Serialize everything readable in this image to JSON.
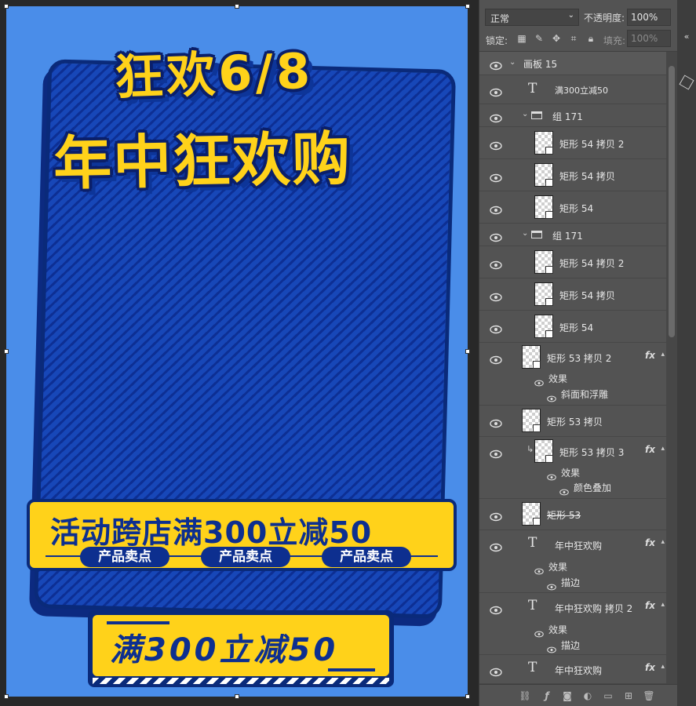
{
  "canvas": {
    "headline_top": "狂欢6/8",
    "headline_main": "年中狂欢购",
    "promo_text": "活动跨店满300立减50",
    "pills": [
      "产品卖点",
      "产品卖点",
      "产品卖点"
    ],
    "bottom_button_text": "满300立减50"
  },
  "layers_panel": {
    "blend_mode": "正常",
    "opacity_label": "不透明度:",
    "opacity_value": "100%",
    "lock_label": "锁定:",
    "fill_label": "填充:",
    "fill_value": "100%",
    "rows": [
      {
        "name": "画板 15"
      },
      {
        "name": "满300立减50"
      },
      {
        "name": "组 171"
      },
      {
        "name": "矩形 54 拷贝 2"
      },
      {
        "name": "矩形 54 拷贝"
      },
      {
        "name": "矩形 54"
      },
      {
        "name": "组 171"
      },
      {
        "name": "矩形 54 拷贝 2"
      },
      {
        "name": "矩形 54 拷贝"
      },
      {
        "name": "矩形 54"
      },
      {
        "name": "矩形 53 拷贝 2"
      },
      {
        "name": "矩形 53 拷贝"
      },
      {
        "name": "矩形 53 拷贝 3"
      },
      {
        "name": "矩形 53"
      },
      {
        "name": "年中狂欢购"
      },
      {
        "name": "年中狂欢购 拷贝 2"
      },
      {
        "name": "年中狂欢购"
      }
    ],
    "effects_label": "效果",
    "effect_bevel": "斜面和浮雕",
    "effect_color_overlay": "颜色叠加",
    "effect_stroke": "描边",
    "fx_label": "fx"
  },
  "colors": {
    "artboard_bg": "#4a8de9",
    "accent_yellow": "#ffd21a",
    "deep_blue": "#0d2f8f",
    "panel_bg": "#535353"
  },
  "icons": [
    "eye-icon",
    "text-layer-icon",
    "folder-icon",
    "chevron-down-icon",
    "link-icon",
    "fx-icon",
    "mask-icon",
    "adjustment-icon",
    "new-group-icon",
    "new-layer-icon",
    "trash-icon"
  ]
}
